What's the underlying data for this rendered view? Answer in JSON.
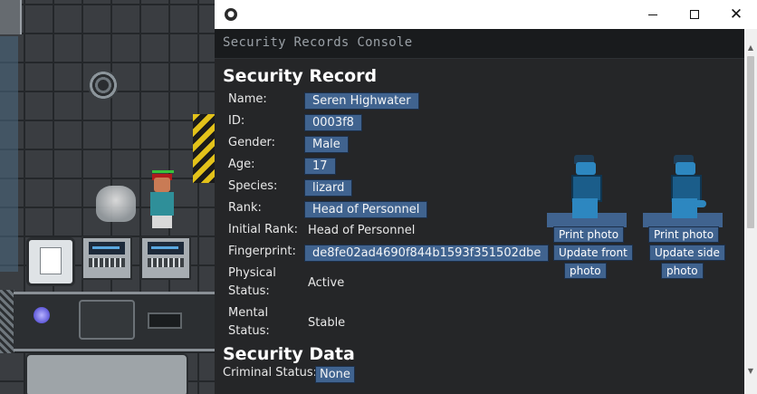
{
  "window": {
    "app_icon": "byond-icon",
    "controls": {
      "minimize": "minimize-icon",
      "maximize": "maximize-icon",
      "close_glyph": "✕"
    }
  },
  "console": {
    "title": "Security Records Console"
  },
  "record": {
    "heading": "Security Record",
    "fields": [
      {
        "label": "Name:",
        "value": "Seren Highwater"
      },
      {
        "label": "ID:",
        "value": "0003f8"
      },
      {
        "label": "Gender:",
        "value": "Male"
      },
      {
        "label": "Age:",
        "value": "17"
      },
      {
        "label": "Species:",
        "value": "lizard"
      },
      {
        "label": "Rank:",
        "value": "Head of Personnel"
      },
      {
        "label": "Initial Rank:",
        "value": "Head of Personnel"
      },
      {
        "label": "Fingerprint:",
        "value": "de8fe02ad4690f844b1593f351502dbe"
      },
      {
        "label_line1": "Physical",
        "label_line2": "Status:",
        "value": "Active"
      },
      {
        "label_line1": "Mental",
        "label_line2": "Status:",
        "value": "Stable"
      }
    ]
  },
  "photos": {
    "front": {
      "print_label": "Print photo",
      "update_label_line1": "Update front",
      "update_label_line2": "photo"
    },
    "side": {
      "print_label": "Print photo",
      "update_label_line1": "Update side",
      "update_label_line2": "photo"
    }
  },
  "security_data": {
    "heading": "Security Data",
    "criminal_label": "Criminal Status:",
    "criminal_value": "None"
  },
  "colors": {
    "accent_button": "#40638f",
    "window_bg": "#252628",
    "hazard_yellow": "#e3c21a"
  }
}
